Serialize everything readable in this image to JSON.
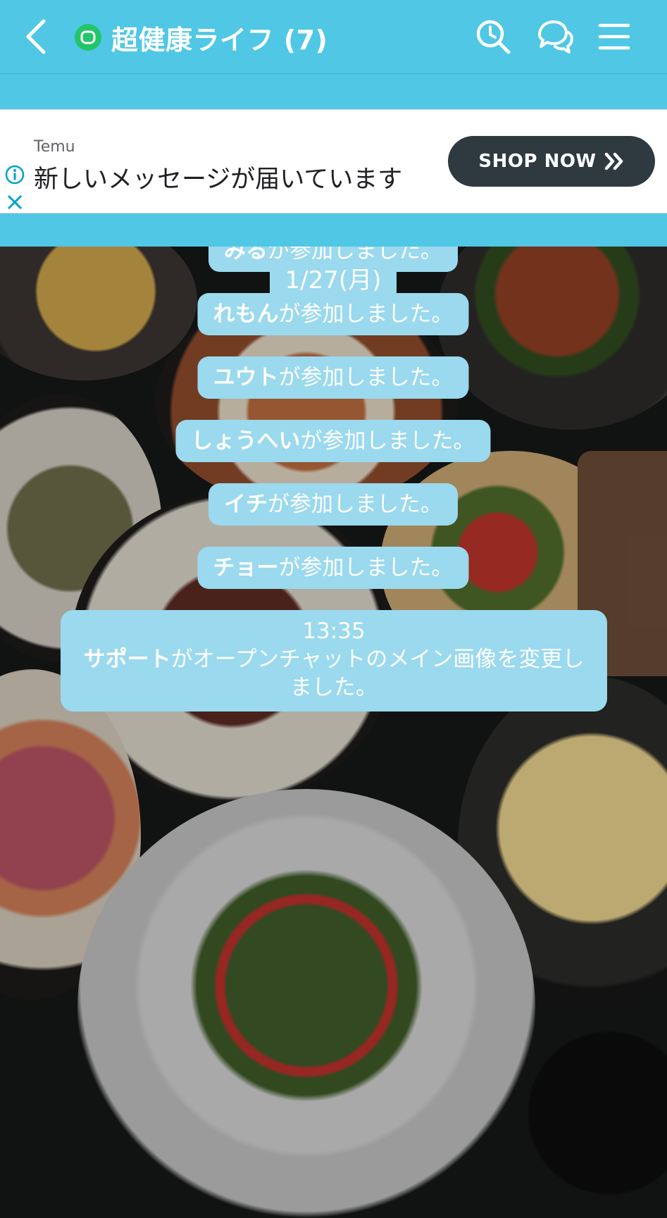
{
  "header": {
    "title": "超健康ライフ (7)",
    "room_icon": "open-chat-icon",
    "icons": [
      "back-arrow-icon",
      "search-icon",
      "chat-bubbles-icon",
      "menu-icon"
    ],
    "bg_color": "#4fc7e5"
  },
  "ad": {
    "brand": "Temu",
    "headline": "新しいメッセージが届いています",
    "cta_label": "SHOP NOW",
    "cta_icon": "double-chevron-right-icon",
    "info_icon": "info-icon",
    "close_icon": "close-icon"
  },
  "messages": {
    "partial": {
      "name": "みる",
      "text": "が参加しました。"
    },
    "date": "1/27(月)",
    "joins": [
      {
        "name": "れもん",
        "text": "が参加しました。"
      },
      {
        "name": "ユウト",
        "text": "が参加しました。"
      },
      {
        "name": "しょうへい",
        "text": "が参加しました。"
      },
      {
        "name": "イチ",
        "text": "が参加しました。"
      },
      {
        "name": "チョー",
        "text": "が参加しました。"
      }
    ],
    "image_change": {
      "time": "13:35",
      "name": "サポート",
      "text": "がオープンチャットのメイン画像を変更しました。"
    }
  },
  "colors": {
    "accent": "#4fc7e5",
    "bubble": "#9ad9ee",
    "ad_button": "#2f3a40"
  }
}
